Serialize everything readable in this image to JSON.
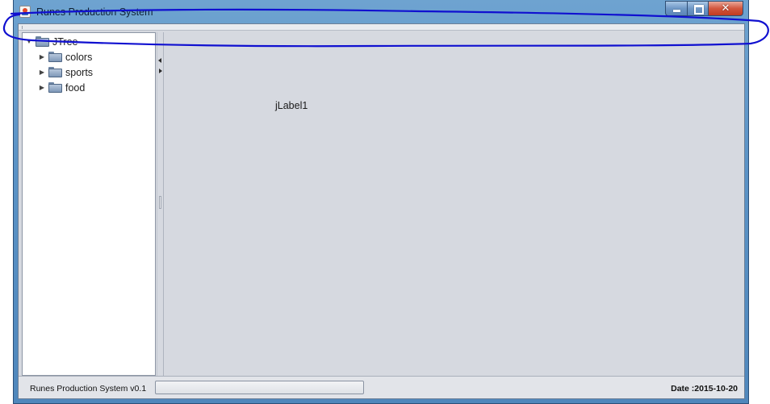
{
  "window": {
    "title": "Runes Production System",
    "close_glyph": "✕"
  },
  "tree": {
    "root": {
      "label": "JTree",
      "expanded": true,
      "toggle": "▼",
      "icon": "folder-open-icon"
    },
    "children": [
      {
        "label": "colors",
        "toggle": "▶",
        "icon": "folder-icon"
      },
      {
        "label": "sports",
        "toggle": "▶",
        "icon": "folder-icon"
      },
      {
        "label": "food",
        "toggle": "▶",
        "icon": "folder-icon"
      }
    ]
  },
  "content": {
    "label": "jLabel1"
  },
  "statusbar": {
    "left_text": "Runes Production System v0.1",
    "progress_value": 0,
    "right_text": "Date :2015-10-20"
  },
  "colors": {
    "annotation_stroke": "#1010d0",
    "window_frame": "#5b93c6",
    "client_background": "#d6d9e0"
  }
}
